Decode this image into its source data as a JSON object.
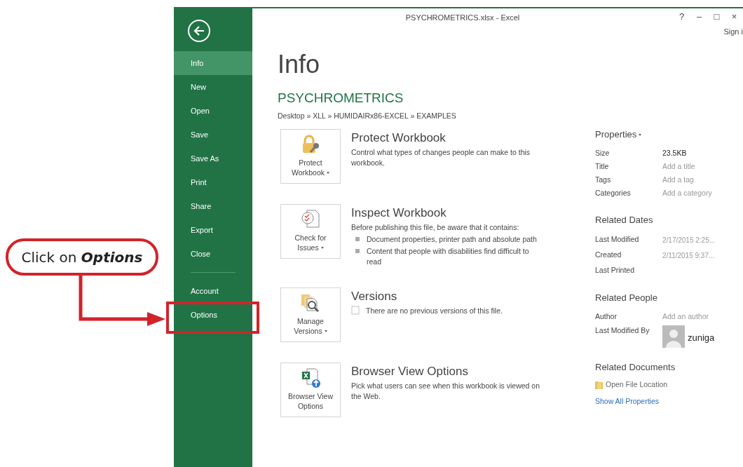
{
  "window": {
    "title": "PSYCHROMETRICS.xlsx - Excel",
    "controls": [
      "?",
      "–",
      "□",
      "×"
    ],
    "sign_in": "Sign i"
  },
  "sidebar": {
    "items": [
      {
        "label": "Info",
        "selected": true
      },
      {
        "label": "New",
        "selected": false
      },
      {
        "label": "Open",
        "selected": false
      },
      {
        "label": "Save",
        "selected": false
      },
      {
        "label": "Save As",
        "selected": false
      },
      {
        "label": "Print",
        "selected": false
      },
      {
        "label": "Share",
        "selected": false
      },
      {
        "label": "Export",
        "selected": false
      },
      {
        "label": "Close",
        "selected": false
      }
    ],
    "footer_items": [
      {
        "label": "Account",
        "selected": false
      },
      {
        "label": "Options",
        "selected": false
      }
    ]
  },
  "callout": {
    "text": "Click on **Options**"
  },
  "info": {
    "heading": "Info",
    "file_name": "PSYCHROMETRICS",
    "path": "Desktop » XLL » HUMIDAIRx86-EXCEL » EXAMPLES",
    "sections": [
      {
        "kind": "plain",
        "button": "Protect Workbook",
        "dropdown": true,
        "title": "Protect Workbook",
        "description": "Control what types of changes people can make to this workbook."
      },
      {
        "kind": "bullets",
        "button": "Check for Issues",
        "dropdown": true,
        "title": "Inspect Workbook",
        "description": "Before publishing this file, be aware that it contains:",
        "bullets": [
          "Document properties, printer path and absolute path",
          "Content that people with disabilities find difficult to read"
        ]
      },
      {
        "kind": "note",
        "button": "Manage Versions",
        "dropdown": true,
        "title": "Versions",
        "description": "There are no previous versions of this file."
      },
      {
        "kind": "plain",
        "button": "Browser View Options",
        "dropdown": false,
        "title": "Browser View Options",
        "description": "Pick what users can see when this workbook is viewed on the Web."
      }
    ]
  },
  "properties": {
    "heading": "Properties",
    "dropdown": true,
    "rows": [
      {
        "label": "Size",
        "value": "23.5KB"
      },
      {
        "label": "Title",
        "placeholder": "Add a title"
      },
      {
        "label": "Tags",
        "placeholder": "Add a tag"
      },
      {
        "label": "Categories",
        "placeholder": "Add a category"
      }
    ]
  },
  "related_dates": {
    "heading": "Related Dates",
    "rows": [
      {
        "label": "Last Modified",
        "value": "2/17/2015 2:25..."
      },
      {
        "label": "Created",
        "value": "2/11/2015 9:37..."
      },
      {
        "label": "Last Printed"
      }
    ]
  },
  "related_people": {
    "heading": "Related People",
    "author_label": "Author",
    "author_placeholder": "Add an author",
    "modified_by_label": "Last Modified By",
    "modified_by": "zuniga"
  },
  "related_documents": {
    "heading": "Related Documents",
    "open_location": "Open File Location",
    "show_all": "Show All Properties"
  }
}
